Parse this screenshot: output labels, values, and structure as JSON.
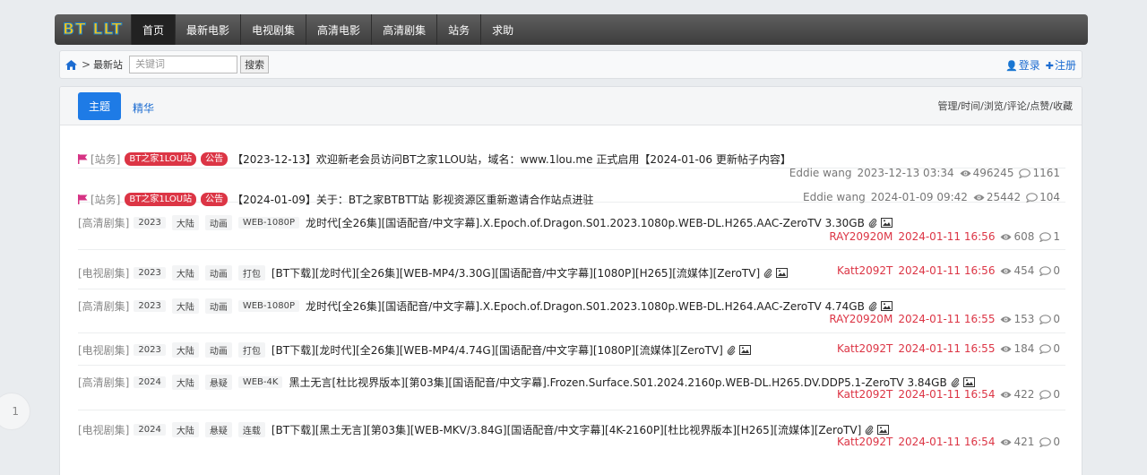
{
  "nav": {
    "logo": "BT LLT",
    "items": [
      "首页",
      "最新电影",
      "电视剧集",
      "高清电影",
      "高清剧集",
      "站务",
      "求助"
    ],
    "active_index": 0
  },
  "crumb": {
    "separator": ">",
    "current": "最新站",
    "search_placeholder": "关键词",
    "search_button": "搜索",
    "login": "登录",
    "register": "注册"
  },
  "tabs": {
    "main": "主题",
    "featured": "精华",
    "sort": "管理/时间/浏览/评论/点赞/收藏"
  },
  "threads": [
    {
      "forum": "[站务]",
      "badges": [
        "BT之家1LOU站",
        "公告"
      ],
      "tags": [],
      "title": "【2023-12-13】欢迎新老会员访问BT之家1LOU站，域名：www.1lou.me 正式启用【2024-01-06 更新帖子内容】",
      "author": "Eddie wang",
      "time": "2023-12-13 03:34",
      "views": "496245",
      "comments": "1161",
      "pinned": true,
      "attach": false,
      "image": false
    },
    {
      "forum": "[站务]",
      "badges": [
        "BT之家1LOU站",
        "公告"
      ],
      "tags": [],
      "title": "【2024-01-09】关于：BT之家BTBTT站 影视资源区重新邀请合作站点进驻",
      "author": "Eddie wang",
      "time": "2024-01-09 09:42",
      "views": "25442",
      "comments": "104",
      "pinned": true,
      "attach": false,
      "image": false
    },
    {
      "forum": "[高清剧集]",
      "badges": [],
      "tags": [
        "2023",
        "大陆",
        "动画",
        "WEB-1080P"
      ],
      "title": "龙时代[全26集][国语配音/中文字幕].X.Epoch.of.Dragon.S01.2023.1080p.WEB-DL.H265.AAC-ZeroTV 3.30GB",
      "author": "RAY20920M",
      "time": "2024-01-11 16:56",
      "views": "608",
      "comments": "1",
      "pinned": false,
      "attach": true,
      "image": true
    },
    {
      "forum": "[电视剧集]",
      "badges": [],
      "tags": [
        "2023",
        "大陆",
        "动画",
        "打包"
      ],
      "title": "[BT下载][龙时代][全26集][WEB-MP4/3.30G][国语配音/中文字幕][1080P][H265][流媒体][ZeroTV]",
      "author": "Katt2092T",
      "time": "2024-01-11 16:56",
      "views": "454",
      "comments": "0",
      "pinned": false,
      "attach": true,
      "image": true
    },
    {
      "forum": "[高清剧集]",
      "badges": [],
      "tags": [
        "2023",
        "大陆",
        "动画",
        "WEB-1080P"
      ],
      "title": "龙时代[全26集][国语配音/中文字幕].X.Epoch.of.Dragon.S01.2023.1080p.WEB-DL.H264.AAC-ZeroTV 4.74GB",
      "author": "RAY20920M",
      "time": "2024-01-11 16:55",
      "views": "153",
      "comments": "0",
      "pinned": false,
      "attach": true,
      "image": true
    },
    {
      "forum": "[电视剧集]",
      "badges": [],
      "tags": [
        "2023",
        "大陆",
        "动画",
        "打包"
      ],
      "title": "[BT下载][龙时代][全26集][WEB-MP4/4.74G][国语配音/中文字幕][1080P][流媒体][ZeroTV]",
      "author": "Katt2092T",
      "time": "2024-01-11 16:55",
      "views": "184",
      "comments": "0",
      "pinned": false,
      "attach": true,
      "image": true
    },
    {
      "forum": "[高清剧集]",
      "badges": [],
      "tags": [
        "2024",
        "大陆",
        "悬疑",
        "WEB-4K"
      ],
      "title": "黑土无言[杜比视界版本][第03集][国语配音/中文字幕].Frozen.Surface.S01.2024.2160p.WEB-DL.H265.DV.DDP5.1-ZeroTV 3.84GB",
      "author": "Katt2092T",
      "time": "2024-01-11 16:54",
      "views": "422",
      "comments": "0",
      "pinned": false,
      "attach": true,
      "image": true
    },
    {
      "forum": "[电视剧集]",
      "badges": [],
      "tags": [
        "2024",
        "大陆",
        "悬疑",
        "连载"
      ],
      "title": "[BT下载][黑土无言][第03集][WEB-MKV/3.84G][国语配音/中文字幕][4K-2160P][杜比视界版本][H265][流媒体][ZeroTV]",
      "author": "Katt2092T",
      "time": "2024-01-11 16:54",
      "views": "421",
      "comments": "0",
      "pinned": false,
      "attach": true,
      "image": true
    }
  ],
  "page_indicator": "1",
  "colors": {
    "accent": "#1e7be6",
    "badge": "#dc3545",
    "nav": "#3c3c3c",
    "link": "#1c6cd1"
  }
}
